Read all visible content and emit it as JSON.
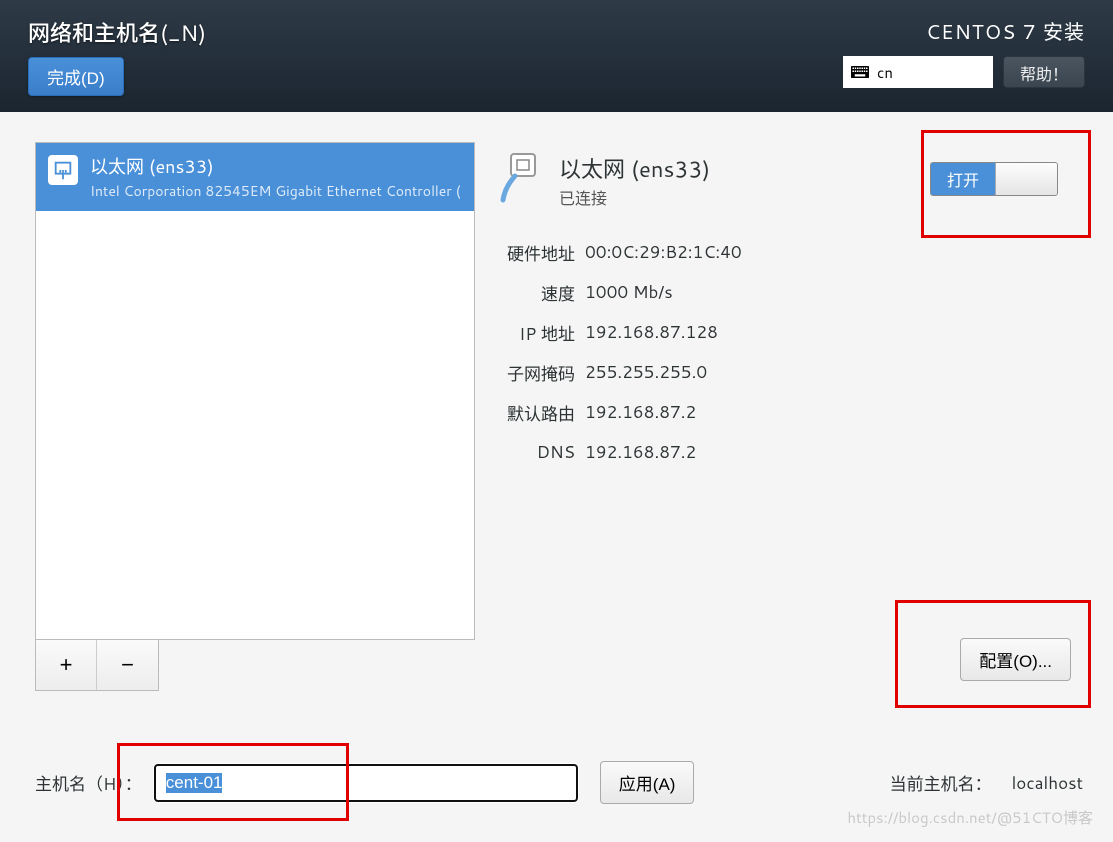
{
  "header": {
    "title": "网络和主机名(_N)",
    "done_label": "完成(D)",
    "install_title": "CENTOS 7 安装",
    "lang_code": "cn",
    "help_label": "帮助！"
  },
  "device_list": [
    {
      "name": "以太网 (ens33)",
      "desc": "Intel Corporation 82545EM Gigabit Ethernet Controller ("
    }
  ],
  "buttons": {
    "add_label": "+",
    "remove_label": "−",
    "config_label": "配置(O)...",
    "apply_label": "应用(A)"
  },
  "detail": {
    "title": "以太网 (ens33)",
    "status": "已连接",
    "toggle_label": "打开",
    "rows": [
      {
        "label": "硬件地址",
        "value": "00:0C:29:B2:1C:40"
      },
      {
        "label": "速度",
        "value": "1000 Mb/s"
      },
      {
        "label": "IP 地址",
        "value": "192.168.87.128"
      },
      {
        "label": "子网掩码",
        "value": "255.255.255.0"
      },
      {
        "label": "默认路由",
        "value": "192.168.87.2"
      },
      {
        "label": "DNS",
        "value": "192.168.87.2"
      }
    ]
  },
  "hostname": {
    "label": "主机名（H）：",
    "value": "cent-01",
    "current_label": "当前主机名：",
    "current_value": "localhost"
  },
  "watermark": "https://blog.csdn.net/@51CTO博客"
}
